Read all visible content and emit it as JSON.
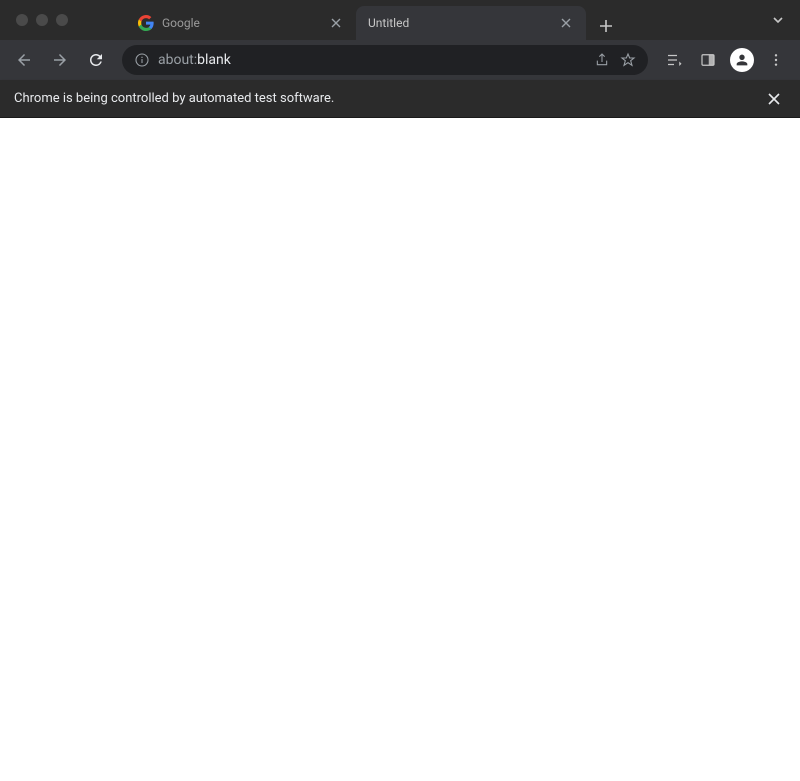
{
  "tabs": [
    {
      "title": "Google",
      "favicon": "google"
    },
    {
      "title": "Untitled",
      "favicon": "none"
    }
  ],
  "omnibox": {
    "prefix": "about:",
    "value": "blank"
  },
  "infobar": {
    "message": "Chrome is being controlled by automated test software."
  }
}
